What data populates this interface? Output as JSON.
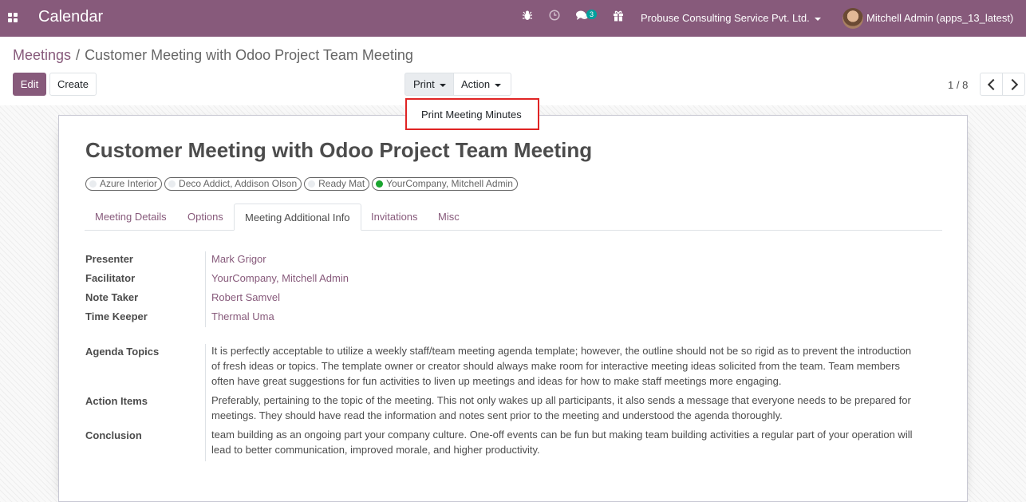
{
  "navbar": {
    "app_title": "Calendar",
    "chat_count": "3",
    "company": "Probuse Consulting Service Pvt. Ltd.",
    "user": "Mitchell Admin (apps_13_latest)"
  },
  "breadcrumb": {
    "parent": "Meetings",
    "separator": "/",
    "current": "Customer Meeting with Odoo Project Team Meeting"
  },
  "buttons": {
    "edit": "Edit",
    "create": "Create",
    "print": "Print",
    "action": "Action"
  },
  "pager": {
    "value": "1 / 8"
  },
  "print_dropdown": {
    "items": [
      "Print Meeting Minutes"
    ]
  },
  "record": {
    "title": "Customer Meeting with Odoo Project Team Meeting",
    "attendees": [
      {
        "name": "Azure Interior",
        "status_color": "#e9ecef"
      },
      {
        "name": "Deco Addict, Addison Olson",
        "status_color": "#e9ecef"
      },
      {
        "name": "Ready Mat",
        "status_color": "#e9ecef"
      },
      {
        "name": "YourCompany, Mitchell Admin",
        "status_color": "#1aa52f"
      }
    ]
  },
  "tabs": [
    "Meeting Details",
    "Options",
    "Meeting Additional Info",
    "Invitations",
    "Misc"
  ],
  "active_tab": "Meeting Additional Info",
  "fields": {
    "presenter": {
      "label": "Presenter",
      "value": "Mark Grigor"
    },
    "facilitator": {
      "label": "Facilitator",
      "value": "YourCompany, Mitchell Admin"
    },
    "note_taker": {
      "label": "Note Taker",
      "value": "Robert Samvel"
    },
    "time_keeper": {
      "label": "Time Keeper",
      "value": "Thermal Uma"
    },
    "agenda_topics": {
      "label": "Agenda Topics",
      "value": "It is perfectly acceptable to utilize a weekly staff/team meeting agenda template; however, the outline should not be so rigid as to prevent the introduction of fresh ideas or topics. The template owner or creator should always make room for interactive meeting ideas solicited from the team. Team members often have great suggestions for fun activities to liven up meetings and ideas for how to make staff meetings more engaging."
    },
    "action_items": {
      "label": "Action Items",
      "value": "Preferably, pertaining to the topic of the meeting. This not only wakes up all participants, it also sends a message that everyone needs to be prepared for meetings. They should have read the information and notes sent prior to the meeting and understood the agenda thoroughly."
    },
    "conclusion": {
      "label": "Conclusion",
      "value": "team building as an ongoing part your company culture. One-off events can be fun but making team building activities a regular part of your operation will lead to better communication, improved morale, and higher productivity."
    }
  },
  "colors": {
    "brand": "#875a7b",
    "dropdown_highlight": "#e02424",
    "badge": "#00a09d"
  }
}
